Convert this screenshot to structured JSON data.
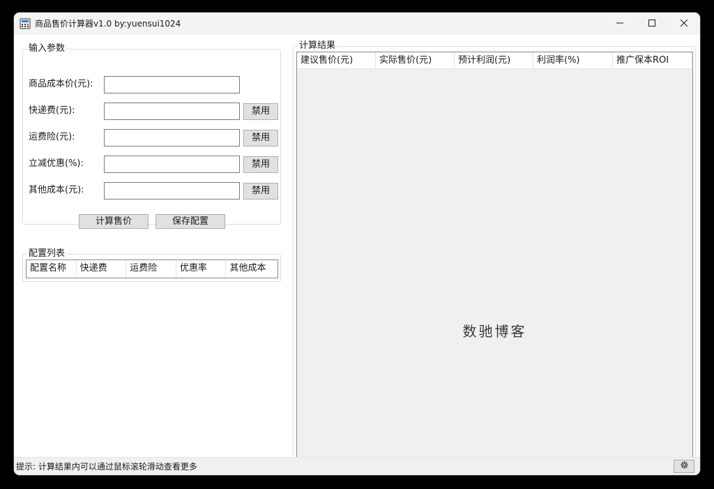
{
  "window": {
    "title": "商品售价计算器v1.0   by:yuensui1024"
  },
  "input_group": {
    "legend": "输入参数",
    "fields": [
      {
        "label": "商品成本价(元):",
        "value": ""
      },
      {
        "label": "快递费(元):",
        "value": "",
        "button": "禁用"
      },
      {
        "label": "运费险(元):",
        "value": "",
        "button": "禁用"
      },
      {
        "label": "立减优惠(%):",
        "value": "",
        "button": "禁用"
      },
      {
        "label": "其他成本(元):",
        "value": "",
        "button": "禁用"
      }
    ],
    "calc_button": "计算售价",
    "save_button": "保存配置"
  },
  "config_group": {
    "legend": "配置列表",
    "columns": [
      "配置名称",
      "快递费",
      "运费险",
      "优惠率",
      "其他成本"
    ]
  },
  "result_group": {
    "legend": "计算结果",
    "columns": [
      "建议售价(元)",
      "实际售价(元)",
      "预计利润(元)",
      "利润率(%)",
      "推广保本ROI"
    ],
    "watermark": "数驰博客"
  },
  "statusbar": {
    "hint": "提示: 计算结果内可以通过鼠标滚轮滑动查看更多",
    "settings_icon": "gear-icon"
  }
}
